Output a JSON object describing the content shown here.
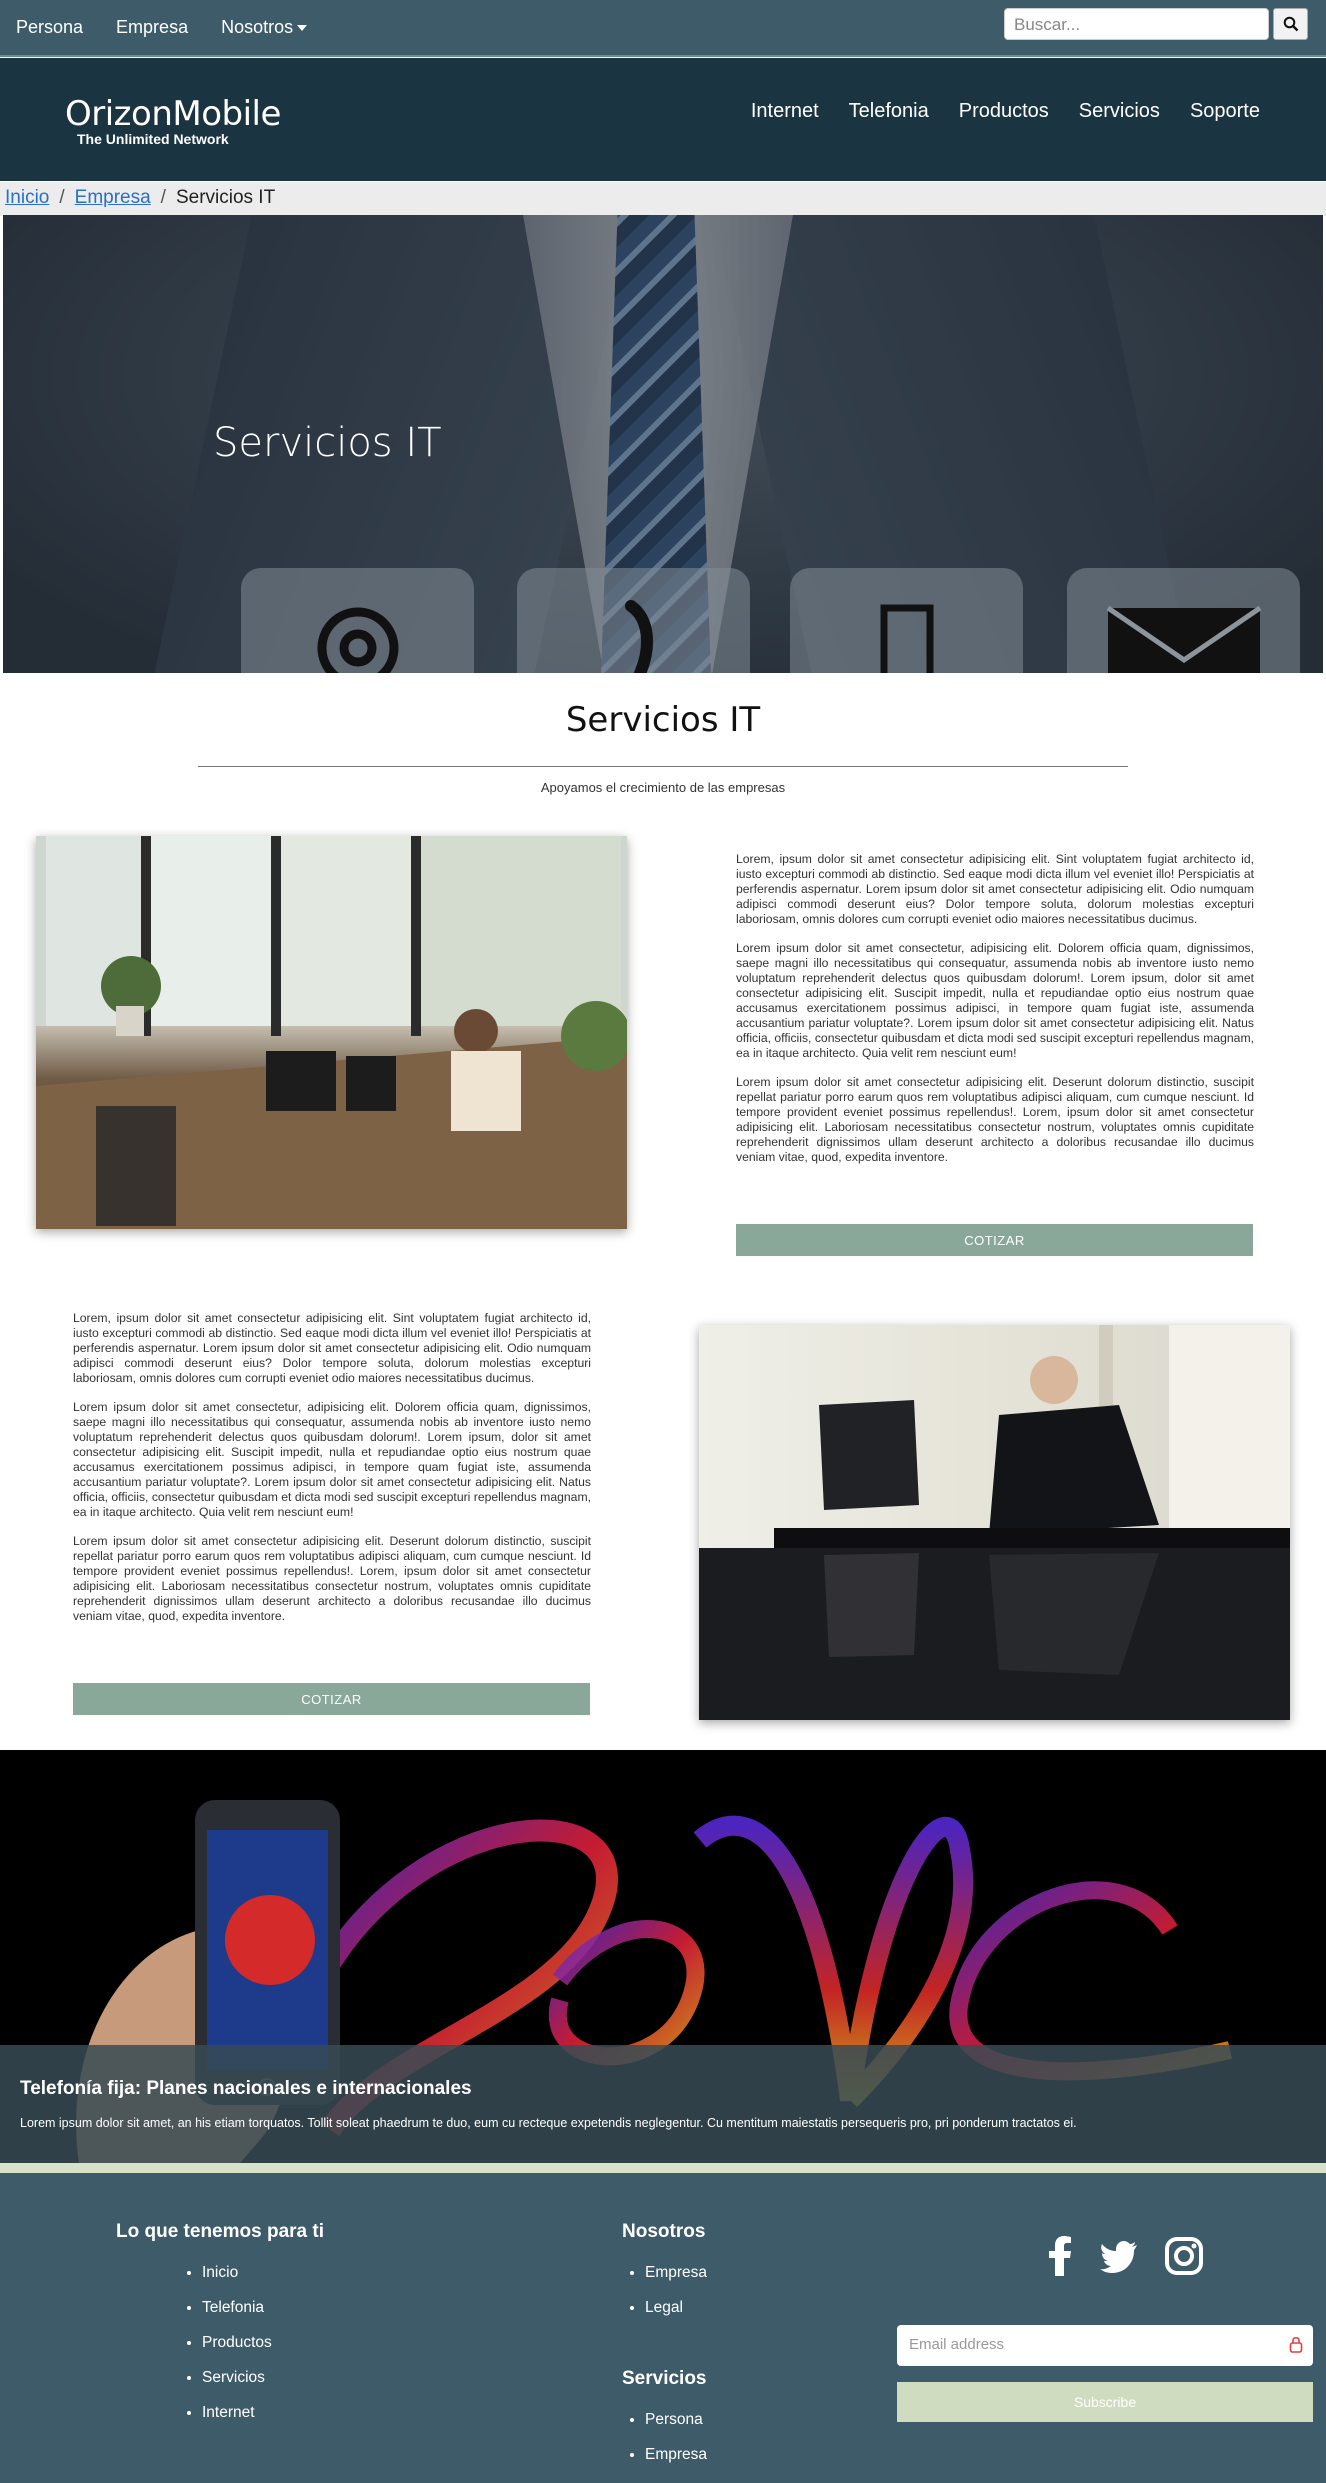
{
  "topbar": {
    "nav": [
      "Persona",
      "Empresa",
      "Nosotros"
    ],
    "search_placeholder": "Buscar..."
  },
  "header": {
    "brand": "OrizonMobile",
    "tagline": "The Unlimited Network",
    "nav": [
      "Internet",
      "Telefonia",
      "Productos",
      "Servicios",
      "Soporte"
    ]
  },
  "breadcrumb": {
    "items": [
      "Inicio",
      "Empresa",
      "Servicios IT"
    ],
    "separator": "/"
  },
  "hero": {
    "title": "Servicios IT",
    "cards": [
      "at-icon",
      "phone-icon",
      "mobile-icon",
      "envelope-icon"
    ]
  },
  "section": {
    "title": "Servicios IT",
    "subtitle": "Apoyamos el crecimiento de las empresas"
  },
  "block1": {
    "paragraphs": [
      "Lorem, ipsum dolor sit amet consectetur adipisicing elit. Sint voluptatem fugiat architecto id, iusto excepturi commodi ab distinctio. Sed eaque modi dicta illum vel eveniet illo! Perspiciatis at perferendis aspernatur. Lorem ipsum dolor sit amet consectetur adipisicing elit. Odio numquam adipisci commodi deserunt eius? Dolor tempore soluta, dolorum molestias excepturi laboriosam, omnis dolores cum corrupti eveniet odio maiores necessitatibus ducimus.",
      "Lorem ipsum dolor sit amet consectetur, adipisicing elit. Dolorem officia quam, dignissimos, saepe magni illo necessitatibus qui consequatur, assumenda nobis ab inventore iusto nemo voluptatum reprehenderit delectus quos quibusdam dolorum!. Lorem ipsum, dolor sit amet consectetur adipisicing elit. Suscipit impedit, nulla et repudiandae optio eius nostrum quae accusamus exercitationem possimus adipisci, in tempore quam fugiat iste, assumenda accusantium pariatur voluptate?. Lorem ipsum dolor sit amet consectetur adipisicing elit. Natus officia, officiis, consectetur quibusdam et dicta modi sed suscipit excepturi repellendus magnam, ea in itaque architecto. Quia velit rem nesciunt eum!",
      "Lorem ipsum dolor sit amet consectetur adipisicing elit. Deserunt dolorum distinctio, suscipit repellat pariatur porro earum quos rem voluptatibus adipisci aliquam, cum cumque nesciunt. Id tempore provident eveniet possimus repellendus!. Lorem, ipsum dolor sit amet consectetur adipisicing elit. Laboriosam necessitatibus consectetur nostrum, voluptates omnis cupiditate reprehenderit dignissimos ullam deserunt architecto a doloribus recusandae illo ducimus veniam vitae, quod, expedita inventore."
    ],
    "button": "COTIZAR"
  },
  "block2": {
    "paragraphs": [
      "Lorem, ipsum dolor sit amet consectetur adipisicing elit. Sint voluptatem fugiat architecto id, iusto excepturi commodi ab distinctio. Sed eaque modi dicta illum vel eveniet illo! Perspiciatis at perferendis aspernatur. Lorem ipsum dolor sit amet consectetur adipisicing elit. Odio numquam adipisci commodi deserunt eius? Dolor tempore soluta, dolorum molestias excepturi laboriosam, omnis dolores cum corrupti eveniet odio maiores necessitatibus ducimus.",
      "Lorem ipsum dolor sit amet consectetur, adipisicing elit. Dolorem officia quam, dignissimos, saepe magni illo necessitatibus qui consequatur, assumenda nobis ab inventore iusto nemo voluptatum reprehenderit delectus quos quibusdam dolorum!. Lorem ipsum, dolor sit amet consectetur adipisicing elit. Suscipit impedit, nulla et repudiandae optio eius nostrum quae accusamus exercitationem possimus adipisci, in tempore quam fugiat iste, assumenda accusantium pariatur voluptate?. Lorem ipsum dolor sit amet consectetur adipisicing elit. Natus officia, officiis, consectetur quibusdam et dicta modi sed suscipit excepturi repellendus magnam, ea in itaque architecto. Quia velit rem nesciunt eum!",
      "Lorem ipsum dolor sit amet consectetur adipisicing elit. Deserunt dolorum distinctio, suscipit repellat pariatur porro earum quos rem voluptatibus adipisci aliquam, cum cumque nesciunt. Id tempore provident eveniet possimus repellendus!. Lorem, ipsum dolor sit amet consectetur adipisicing elit. Laboriosam necessitatibus consectetur nostrum, voluptates omnis cupiditate reprehenderit dignissimos ullam deserunt architecto a doloribus recusandae illo ducimus veniam vitae, quod, expedita inventore."
    ],
    "button": "COTIZAR"
  },
  "promo": {
    "title": "Telefonía fija: Planes nacionales e internacionales",
    "text": "Lorem ipsum dolor sit amet, an his etiam torquatos. Tollit soleat phaedrum te duo, eum cu recteque expetendis neglegentur. Cu mentitum maiestatis persequeris pro, pri ponderum tractatos ei."
  },
  "footer": {
    "col1_title": "Lo que tenemos para ti",
    "col1_items": [
      "Inicio",
      "Telefonia",
      "Productos",
      "Servicios",
      "Internet"
    ],
    "col2_title": "Nosotros",
    "col2_items": [
      "Empresa",
      "Legal"
    ],
    "col3_title": "Servicios",
    "col3_items": [
      "Persona",
      "Empresa"
    ],
    "social": [
      "facebook-icon",
      "twitter-icon",
      "instagram-icon"
    ],
    "email_placeholder": "Email address",
    "subscribe": "Subscribe"
  }
}
